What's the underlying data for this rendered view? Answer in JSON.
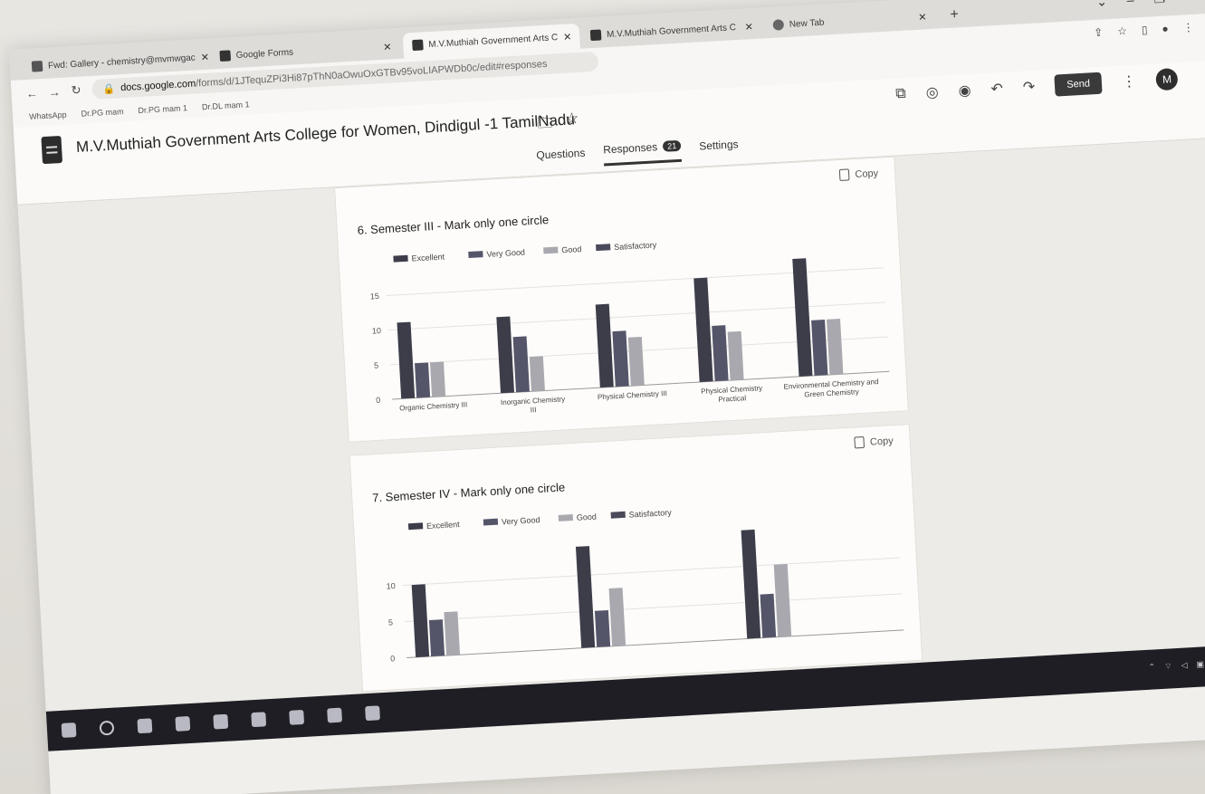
{
  "browser": {
    "tabs": [
      {
        "label": "Fwd: Gallery - chemistry@mvmwgac",
        "color": "#5a5a5a"
      },
      {
        "label": "Google Forms",
        "color": "#3a3a3a"
      },
      {
        "label": "M.V.Muthiah Government Arts C",
        "color": "#3a3a3a"
      },
      {
        "label": "M.V.Muthiah Government Arts C",
        "color": "#3a3a3a"
      },
      {
        "label": "New Tab",
        "color": "#5a5a5a"
      }
    ],
    "url_host": "docs.google.com",
    "url_path": "/forms/d/1JTequZPi3Hi87pThN0aOwuOxGTBv95voLIAPWDb0c/edit#responses",
    "bookmarks": [
      "WhatsApp",
      "Dr.PG mam",
      "Dr.PG mam 1",
      "Dr.DL mam 1"
    ]
  },
  "header": {
    "title": "M.V.Muthiah Government Arts College for Women, Dindigul -1 TamilNadu",
    "send_label": "Send",
    "avatar_letter": "M",
    "tabs": [
      {
        "label": "Questions"
      },
      {
        "label": "Responses",
        "badge": "21"
      },
      {
        "label": "Settings"
      }
    ]
  },
  "cards": [
    {
      "title": "6. Semester III - Mark only one circle",
      "copy_label": "Copy"
    },
    {
      "title": "7. Semester IV - Mark only one circle",
      "copy_label": "Copy"
    }
  ],
  "chart_data": [
    {
      "type": "bar",
      "title": "6. Semester III - Mark only one circle",
      "categories": [
        "Organic Chemistry III",
        "Inorganic Chemistry III",
        "Physical Chemistry III",
        "Physical Chemistry Practical",
        "Environmental Chemistry and Green Chemistry"
      ],
      "series": [
        {
          "name": "Excellent",
          "values": [
            11,
            11,
            12,
            15,
            17
          ],
          "color": "#3d3d4a"
        },
        {
          "name": "Very Good",
          "values": [
            5,
            8,
            8,
            8,
            8
          ],
          "color": "#55556a"
        },
        {
          "name": "Good",
          "values": [
            5,
            5,
            7,
            7,
            8
          ],
          "color": "#a8a8ae"
        },
        {
          "name": "Satisfactory",
          "values": [
            0,
            0,
            0,
            0,
            0
          ],
          "color": "#4a4a5a"
        }
      ],
      "ylim": [
        0,
        17
      ],
      "yticks": [
        0,
        5,
        10,
        15
      ],
      "grid": true,
      "legend": "top-left"
    },
    {
      "type": "bar",
      "title": "7. Semester IV - Mark only one circle",
      "categories": [
        "",
        "",
        ""
      ],
      "series": [
        {
          "name": "Excellent",
          "values": [
            10,
            14,
            15
          ],
          "color": "#3d3d4a"
        },
        {
          "name": "Very Good",
          "values": [
            5,
            5,
            6
          ],
          "color": "#55556a"
        },
        {
          "name": "Good",
          "values": [
            6,
            8,
            10
          ],
          "color": "#a8a8ae"
        },
        {
          "name": "Satisfactory",
          "values": [
            0,
            0,
            0
          ],
          "color": "#4a4a5a"
        }
      ],
      "ylim": [
        0,
        15
      ],
      "yticks": [
        0,
        5,
        10
      ],
      "grid": true,
      "legend": "top-left"
    }
  ]
}
